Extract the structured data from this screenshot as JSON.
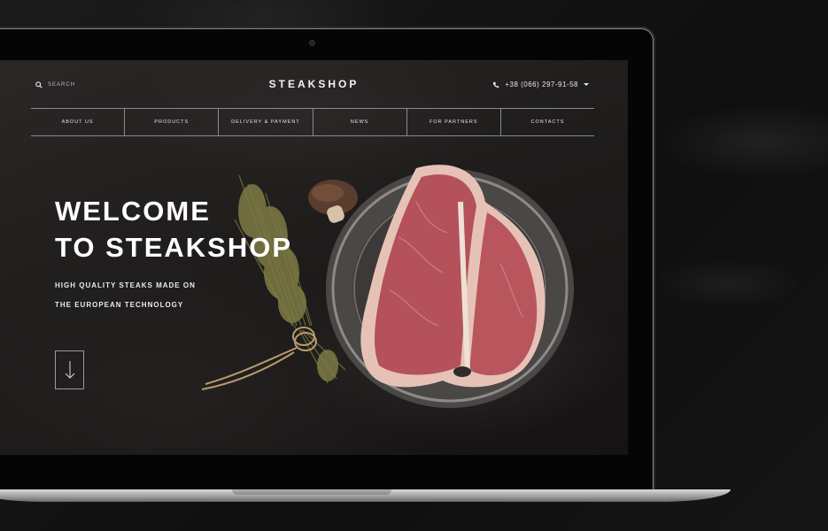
{
  "header": {
    "search_label": "SEARCH",
    "logo": "STEAKSHOP",
    "phone": "+38 (066) 297-91-58"
  },
  "nav": {
    "items": [
      "ABOUT US",
      "PRODUCTS",
      "DELIVERY & PAYMENT",
      "NEWS",
      "FOR PARTNERS",
      "CONTACTS"
    ]
  },
  "hero": {
    "title_line1": "WELCOME",
    "title_line2": "TO STEAKSHOP",
    "subtitle_line1": "HIGH QUALITY STEAKS MADE ON",
    "subtitle_line2": "THE EUROPEAN TECHNOLOGY"
  },
  "icons": {
    "search": "search-icon",
    "phone": "phone-icon",
    "dropdown": "chevron-down-icon",
    "scroll": "arrow-down-icon"
  },
  "colors": {
    "background": "#1e1b1b",
    "text": "#ffffff",
    "divider": "#8a8a8a",
    "meat": "#b5535a",
    "fat": "#e8c4b8"
  }
}
